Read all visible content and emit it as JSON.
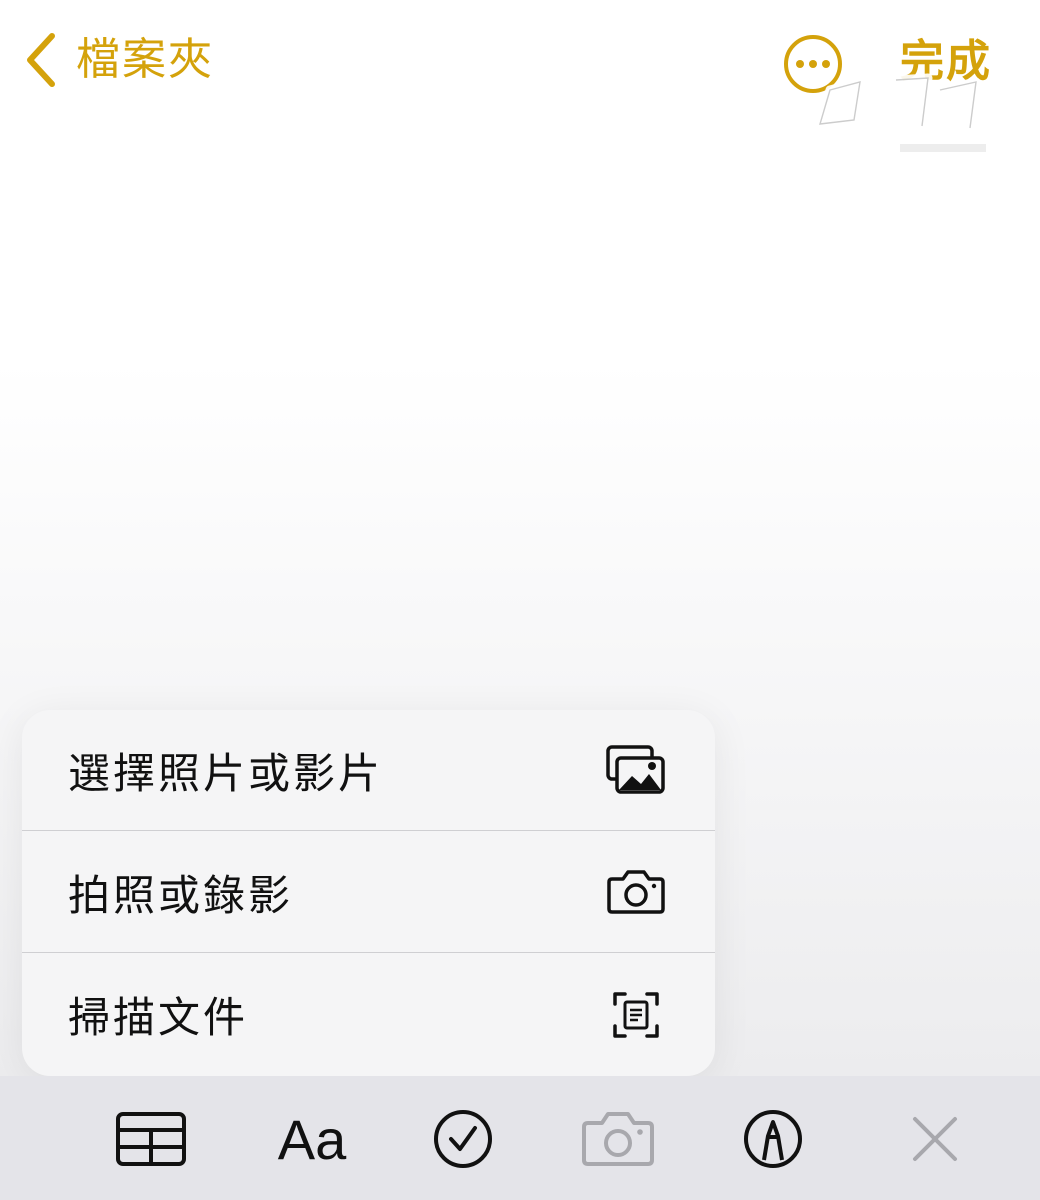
{
  "nav": {
    "back_label": "檔案夾",
    "done_label": "完成",
    "accent_color": "#d4a20b"
  },
  "attachment_menu": {
    "items": [
      {
        "label": "選擇照片或影片",
        "icon": "photo-library-icon"
      },
      {
        "label": "拍照或錄影",
        "icon": "camera-icon"
      },
      {
        "label": "掃描文件",
        "icon": "scan-document-icon"
      }
    ]
  },
  "toolbar": {
    "text_style_label": "Aa",
    "buttons": [
      {
        "icon": "table-icon",
        "enabled": true
      },
      {
        "icon": "text-format-icon",
        "enabled": true
      },
      {
        "icon": "checklist-icon",
        "enabled": true
      },
      {
        "icon": "camera-icon",
        "enabled": false
      },
      {
        "icon": "markup-pen-icon",
        "enabled": true
      },
      {
        "icon": "close-icon",
        "enabled": true
      }
    ]
  }
}
